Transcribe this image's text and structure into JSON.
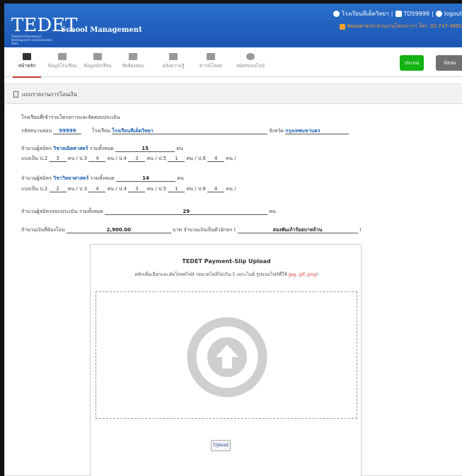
{
  "header": {
    "logo": "TEDET",
    "logo_sub": "Thailand Educational Development and Evaluation Tests",
    "app_title": "School Management",
    "school_name": "โรงเรียนทีเด็ตวิทยา",
    "user_code": "TD59999",
    "logout_label": "logout",
    "notice": "ติดต่อฝ่ายประสานงานโครงการฯ โทร. 02-747-3881"
  },
  "nav": {
    "items": [
      {
        "label": "หน้าหลัก",
        "icon": "dashboard-icon"
      },
      {
        "label": "ข้อมูลโรงเรียน",
        "icon": "school-icon"
      },
      {
        "label": "ข้อมูลนักเรียน",
        "icon": "student-icon"
      },
      {
        "label": "จัดห้องสอบ",
        "icon": "grid-icon"
      },
      {
        "label": "คลังความรู้",
        "icon": "book-icon"
      },
      {
        "label": "ดาวน์โหลด",
        "icon": "download-icon"
      },
      {
        "label": "สมัครออนไลน์",
        "icon": "globe-icon"
      }
    ],
    "btn_green": "ประถม",
    "btn_grey": "มัธยม"
  },
  "panel": {
    "title": "แบบรายงานการโอนเงิน",
    "section_title": "โรงเรียนที่เข้าร่วมโครงการและจัดสอบประเมิน",
    "exam_code_label": "รหัสสนามสอบ",
    "exam_code": "99999",
    "school_label": "โรงเรียน",
    "school": "โรงเรียนทีเด็ตวิทยา",
    "province_label": "จังหวัด",
    "province": "กรุงเทพมหานคร",
    "math": {
      "label_prefix": "จำนวนผู้สมัคร",
      "subject": "วิชาคณิตศาสตร์",
      "total_label": "รวมทั้งหมด",
      "total": "15",
      "unit": "คน",
      "split_label": "แบ่งเป็น",
      "p2_label": "ป.2",
      "p2": "3",
      "p3_label": "ป.3",
      "p3": "4",
      "p4_label": "ป.4",
      "p4": "3",
      "p5_label": "ป.5",
      "p5": "1",
      "p6_label": "ป.6",
      "p6": "4"
    },
    "science": {
      "label_prefix": "จำนวนผู้สมัคร",
      "subject": "วิชาวิทยาศาสตร์",
      "total_label": "รวมทั้งหมด",
      "total": "14",
      "unit": "คน",
      "split_label": "แบ่งเป็น",
      "p2_label": "ป.2",
      "p2": "2",
      "p3_label": "ป.3",
      "p3": "4",
      "p4_label": "ป.4",
      "p4": "3",
      "p5_label": "ป.5",
      "p5": "1",
      "p6_label": "ป.6",
      "p6": "4"
    },
    "total_applicants_label": "จำนวนผู้สมัครสอบประเมิน รวมทั้งหมด",
    "total_applicants": "29",
    "total_unit": "คน",
    "amount_label": "จำนวนเงินที่ต้องโอน",
    "amount": "2,900.00",
    "baht_label": "บาท",
    "amount_text_label": "จำนวนเงินเป็นตัวอักษร (",
    "amount_text": "สองพันเก้าร้อยบาทถ้วน",
    "close_paren": ")",
    "unit_sep": "คน /"
  },
  "upload": {
    "title": "TEDET Payment-Slip Upload",
    "hint": "คลิกเพื่อเลือกและอัพโหลดไฟล์ (ขนาดไฟล์ไม่เกิน 5 เมกะไบต์ รูปแบบไฟล์ที่ใช้",
    "hint_types": "jpg, gif, png",
    "hint_end": ")",
    "button": "Upload",
    "icon": "upload-arrow-icon"
  },
  "colors": {
    "header_blue": "#1b56b4",
    "green": "#12b312",
    "accent_blue": "#1a5fb4",
    "upload_icon": "#cfcfcf"
  }
}
